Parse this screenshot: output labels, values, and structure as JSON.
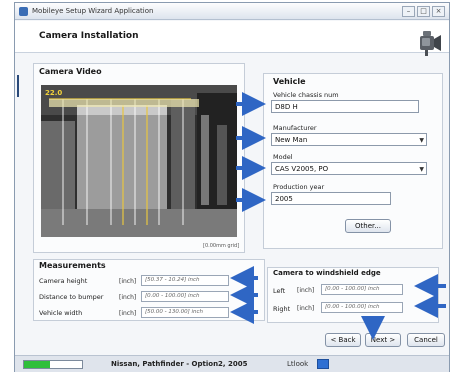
{
  "window": {
    "title": "Mobileye Setup Wizard Application"
  },
  "header": {
    "title": "Camera Installation"
  },
  "camera_video": {
    "title": "Camera Video",
    "caption": "[0.00mm grid]",
    "overlay_label": "22.0"
  },
  "vehicle": {
    "title": "Vehicle",
    "chassis_label": "Vehicle chassis num",
    "chassis_value": "D8D H",
    "manufacturer_label": "Manufacturer",
    "manufacturer_value": "New Man",
    "model_label": "Model",
    "model_value": "CAS V2005, PO",
    "year_label": "Production year",
    "year_value": "2005",
    "other_button": "Other..."
  },
  "measurements": {
    "title": "Measurements",
    "rows": [
      {
        "label": "Camera height",
        "unit": "[inch]",
        "placeholder": "[50.37 - 10.24] inch"
      },
      {
        "label": "Distance to bumper",
        "unit": "[inch]",
        "placeholder": "[0.00 - 100.00] inch"
      },
      {
        "label": "Vehicle width",
        "unit": "[inch]",
        "placeholder": "[50.00 - 130.00] inch"
      }
    ]
  },
  "windshield": {
    "title": "Camera to windshield edge",
    "rows": [
      {
        "label": "Left",
        "unit": "[inch]",
        "placeholder": "[0.00 - 100.00] inch"
      },
      {
        "label": "Right",
        "unit": "[inch]",
        "placeholder": "[0.00 - 100.00] inch"
      }
    ]
  },
  "buttons": {
    "back": "< Back",
    "next": "Next >",
    "cancel": "Cancel"
  },
  "status": {
    "vehicle": "Nissan, Pathfinder - Option2, 2005",
    "language": "Ltlook",
    "progress_fraction": 0.45
  },
  "colors": {
    "arrow": "#2f66c4",
    "progress": "#2fbf3a"
  }
}
